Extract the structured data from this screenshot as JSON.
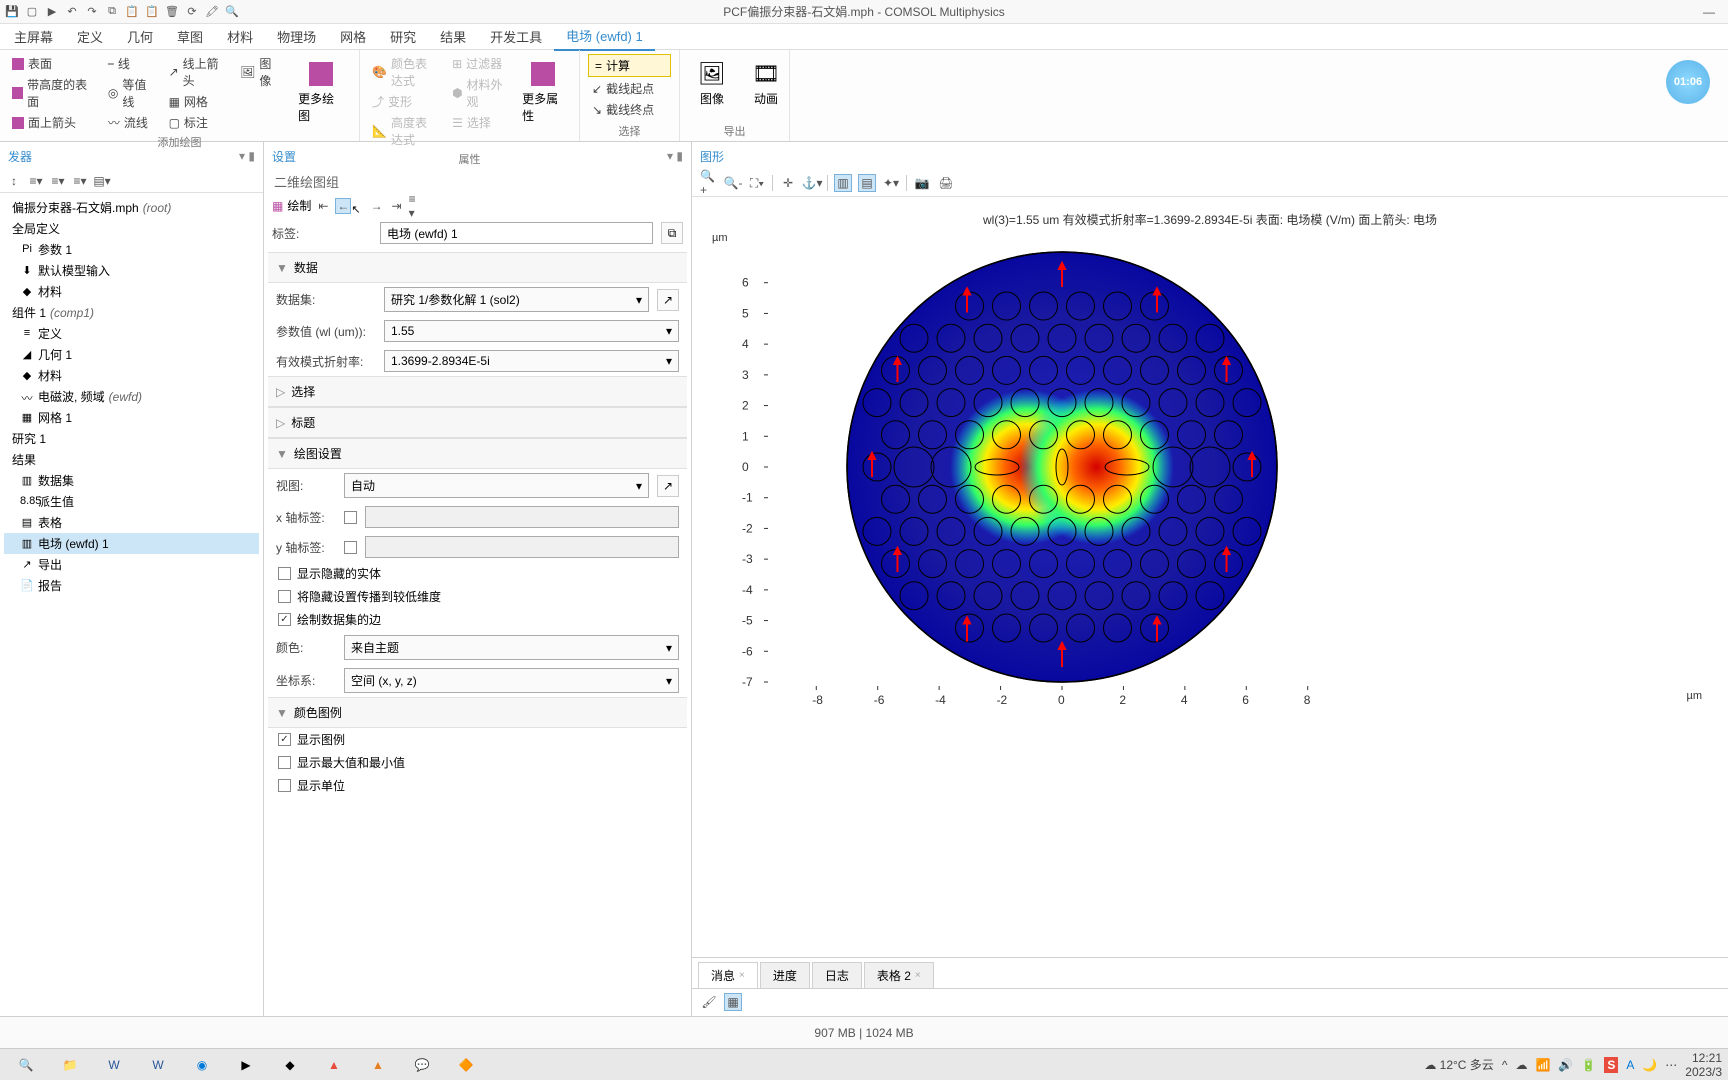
{
  "window": {
    "title": "PCF偏振分束器-石文娟.mph - COMSOL Multiphysics"
  },
  "ribbon_tabs": [
    "主屏幕",
    "定义",
    "几何",
    "草图",
    "材料",
    "物理场",
    "网格",
    "研究",
    "结果",
    "开发工具",
    "电场 (ewfd) 1"
  ],
  "ribbon_tabs_active": 10,
  "ribbon": {
    "add_plot": {
      "label": "添加绘图",
      "surface": "表面",
      "line": "线",
      "line_arrow": "线上箭头",
      "image": "图像",
      "height_surface": "带高度的表面",
      "contour": "等值线",
      "mesh": "网格",
      "surface_arrow": "面上箭头",
      "streamline": "流线",
      "annotation": "标注",
      "more": "更多绘图"
    },
    "attrs": {
      "label": "属性",
      "colorexpr": "颜色表达式",
      "deform": "变形",
      "heightexpr": "高度表达式",
      "filter": "过滤器",
      "matapp": "材料外观",
      "select": "选择",
      "more": "更多属性"
    },
    "select": {
      "label": "选择",
      "compute": "计算",
      "cl_start": "截线起点",
      "cl_end": "截线终点"
    },
    "export": {
      "label": "导出",
      "image": "图像",
      "anim": "动画"
    }
  },
  "tree": {
    "header": "发器",
    "root": "偏振分束器-石文娟.mph",
    "root_tag": "(root)",
    "items": [
      {
        "label": "全局定义",
        "lvl": 0
      },
      {
        "label": "参数 1",
        "lvl": 1,
        "icon": "Pi"
      },
      {
        "label": "默认模型输入",
        "lvl": 1,
        "icon": "⬇"
      },
      {
        "label": "材料",
        "lvl": 1,
        "icon": "◆"
      },
      {
        "label": "组件 1",
        "tag": "(comp1)",
        "lvl": 0
      },
      {
        "label": "定义",
        "lvl": 1,
        "icon": "≡"
      },
      {
        "label": "几何 1",
        "lvl": 1,
        "icon": "◢"
      },
      {
        "label": "材料",
        "lvl": 1,
        "icon": "◆"
      },
      {
        "label": "电磁波, 频域",
        "tag": "(ewfd)",
        "lvl": 1,
        "icon": "〰"
      },
      {
        "label": "网格 1",
        "lvl": 1,
        "icon": "▦"
      },
      {
        "label": "研究 1",
        "lvl": 0
      },
      {
        "label": "结果",
        "lvl": 0
      },
      {
        "label": "数据集",
        "lvl": 1,
        "icon": "▥"
      },
      {
        "label": "派生值",
        "lvl": 1,
        "icon": "8.85"
      },
      {
        "label": "表格",
        "lvl": 1,
        "icon": "▤"
      },
      {
        "label": "电场 (ewfd) 1",
        "lvl": 1,
        "icon": "▥",
        "selected": true
      },
      {
        "label": "导出",
        "lvl": 1,
        "icon": "↗"
      },
      {
        "label": "报告",
        "lvl": 1,
        "icon": "📄"
      }
    ]
  },
  "settings": {
    "header": "设置",
    "subtitle": "二维绘图组",
    "plot_btn": "绘制",
    "label_label": "标签:",
    "label_value": "电场 (ewfd) 1",
    "data_hdr": "数据",
    "dataset_label": "数据集:",
    "dataset_value": "研究 1/参数化解 1 (sol2)",
    "param_label": "参数值 (wl (um)):",
    "param_value": "1.55",
    "neff_label": "有效模式折射率:",
    "neff_value": "1.3699-2.8934E-5i",
    "select_hdr": "选择",
    "title_hdr": "标题",
    "plotset_hdr": "绘图设置",
    "view_label": "视图:",
    "view_value": "自动",
    "xlabel_label": "x 轴标签:",
    "ylabel_label": "y 轴标签:",
    "chk_hidden": "显示隐藏的实体",
    "chk_propagate": "将隐藏设置传播到较低维度",
    "chk_edges": "绘制数据集的边",
    "color_label": "颜色:",
    "color_value": "来自主题",
    "coord_label": "坐标系:",
    "coord_value": "空间  (x, y, z)",
    "legend_hdr": "颜色图例",
    "chk_legend": "显示图例",
    "chk_minmax": "显示最大值和最小值",
    "chk_unit": "显示单位"
  },
  "graphics": {
    "header": "图形",
    "title": "wl(3)=1.55 um 有效模式折射率=1.3699-2.8934E-5i   表面: 电场模 (V/m)   面上箭头: 电场",
    "unit": "µm"
  },
  "chart_data": {
    "type": "heatmap",
    "title": "电场模 (V/m) with 电场 arrows",
    "xlabel": "µm",
    "ylabel": "µm",
    "xlim": [
      -9,
      9
    ],
    "ylim": [
      -7.5,
      7
    ],
    "xticks": [
      -8,
      -6,
      -4,
      -2,
      0,
      2,
      4,
      6,
      8
    ],
    "yticks": [
      -7,
      -6,
      -5,
      -4,
      -3,
      -2,
      -1,
      0,
      1,
      2,
      3,
      4,
      5,
      6
    ],
    "fiber_radius": 6.8,
    "hole_radius_small": 0.5,
    "hole_radius_large": 0.7,
    "lattice_pitch": 1.2,
    "hotspot_centers": [
      [
        -2,
        0
      ],
      [
        2,
        0
      ]
    ],
    "colormap": "rainbow (blue low → red high)",
    "arrow_field": "vertical (Ey dominant) red arrows at periphery"
  },
  "bottom_tabs": [
    {
      "label": "消息",
      "closable": true,
      "active": true
    },
    {
      "label": "进度"
    },
    {
      "label": "日志"
    },
    {
      "label": "表格 2",
      "closable": true
    }
  ],
  "status": {
    "mem": "907 MB | 1024 MB"
  },
  "taskbar": {
    "weather": "12°C 多云",
    "time": "12:21",
    "date": "2023/3"
  },
  "clock_badge": "01:06"
}
